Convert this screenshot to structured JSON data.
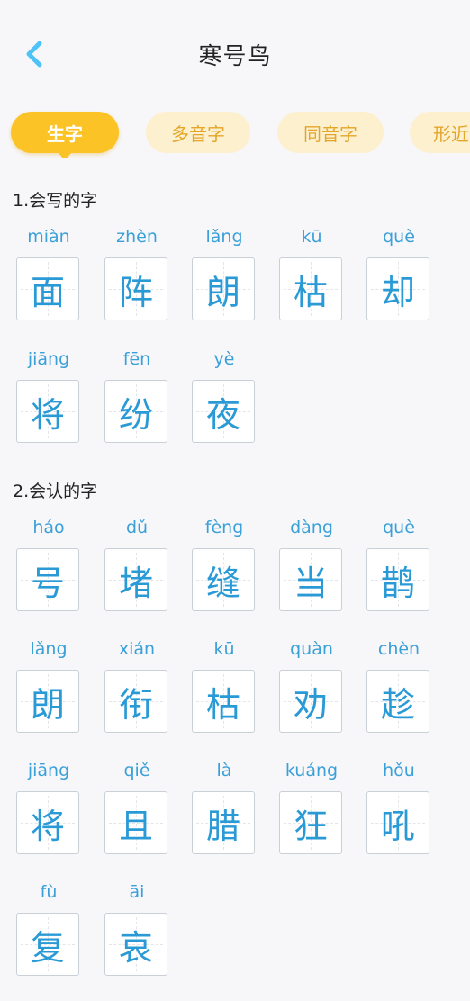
{
  "header": {
    "title": "寒号鸟"
  },
  "tabs": [
    {
      "label": "生字",
      "active": true
    },
    {
      "label": "多音字",
      "active": false
    },
    {
      "label": "同音字",
      "active": false
    },
    {
      "label": "形近字",
      "active": false
    }
  ],
  "sections": [
    {
      "title": "1.会写的字",
      "chars": [
        {
          "pinyin": "miàn",
          "hanzi": "面"
        },
        {
          "pinyin": "zhèn",
          "hanzi": "阵"
        },
        {
          "pinyin": "lǎng",
          "hanzi": "朗"
        },
        {
          "pinyin": "kū",
          "hanzi": "枯"
        },
        {
          "pinyin": "què",
          "hanzi": "却"
        },
        {
          "pinyin": "jiāng",
          "hanzi": "将"
        },
        {
          "pinyin": "fēn",
          "hanzi": "纷"
        },
        {
          "pinyin": "yè",
          "hanzi": "夜"
        }
      ]
    },
    {
      "title": "2.会认的字",
      "chars": [
        {
          "pinyin": "háo",
          "hanzi": "号"
        },
        {
          "pinyin": "dǔ",
          "hanzi": "堵"
        },
        {
          "pinyin": "fèng",
          "hanzi": "缝"
        },
        {
          "pinyin": "dàng",
          "hanzi": "当"
        },
        {
          "pinyin": "què",
          "hanzi": "鹊"
        },
        {
          "pinyin": "lǎng",
          "hanzi": "朗"
        },
        {
          "pinyin": "xián",
          "hanzi": "衔"
        },
        {
          "pinyin": "kū",
          "hanzi": "枯"
        },
        {
          "pinyin": "quàn",
          "hanzi": "劝"
        },
        {
          "pinyin": "chèn",
          "hanzi": "趁"
        },
        {
          "pinyin": "jiāng",
          "hanzi": "将"
        },
        {
          "pinyin": "qiě",
          "hanzi": "且"
        },
        {
          "pinyin": "là",
          "hanzi": "腊"
        },
        {
          "pinyin": "kuáng",
          "hanzi": "狂"
        },
        {
          "pinyin": "hǒu",
          "hanzi": "吼"
        },
        {
          "pinyin": "fù",
          "hanzi": "复"
        },
        {
          "pinyin": "āi",
          "hanzi": "哀"
        }
      ]
    }
  ],
  "colors": {
    "accent": "#fcc326",
    "tab_inactive_bg": "#fdf0cf",
    "char_blue": "#2a9ad6",
    "back_icon": "#4fc3f7"
  },
  "icons": {
    "back": "chevron-left-icon"
  }
}
